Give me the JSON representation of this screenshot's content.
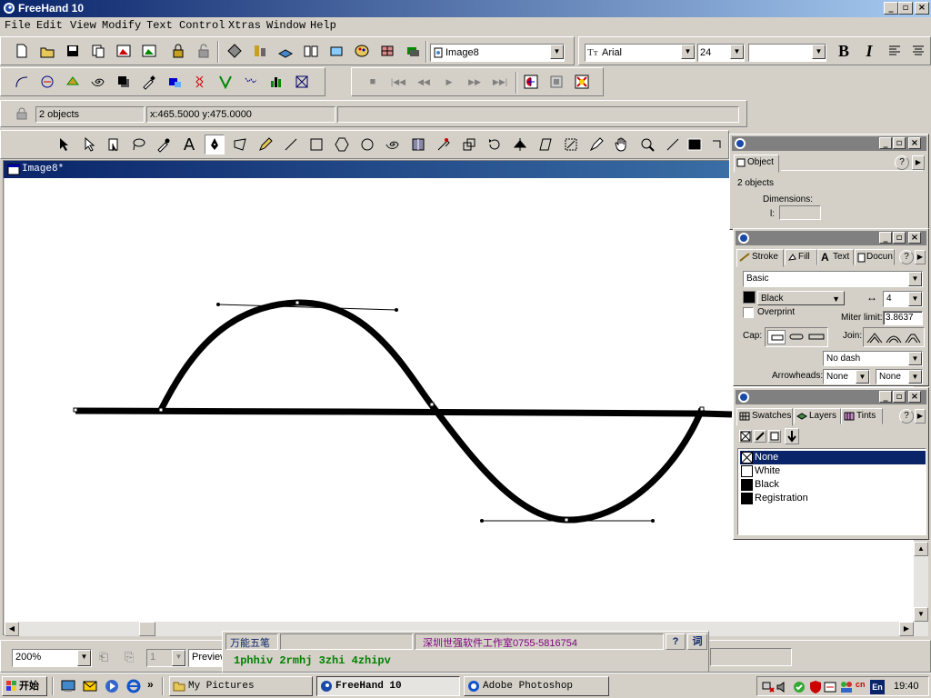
{
  "app": {
    "title": "FreeHand 10"
  },
  "menus": [
    "File",
    "Edit",
    "View",
    "Modify",
    "Text",
    "Control",
    "Xtras",
    "Window",
    "Help"
  ],
  "toolbar": {
    "document_select": "Image8",
    "font_family": "Arial",
    "font_size": "24"
  },
  "status": {
    "selection": "2 objects",
    "coords": "x:465.5000  y:475.0000"
  },
  "document": {
    "title": "Image8*"
  },
  "object_panel": {
    "tab": "Object",
    "summary": "2 objects",
    "dimensions_label": "Dimensions:",
    "l_label": "l:"
  },
  "stroke_panel": {
    "tabs": [
      "Stroke",
      "Fill",
      "Text",
      "Docun"
    ],
    "type": "Basic",
    "color": "Black",
    "width": "4",
    "overprint": "Overprint",
    "miter_label": "Miter limit:",
    "miter_value": "3.8637",
    "cap_label": "Cap:",
    "join_label": "Join:",
    "dash": "No dash",
    "arrowheads_label": "Arrowheads:",
    "arrow_start": "None",
    "arrow_end": "None"
  },
  "swatches_panel": {
    "tabs": [
      "Swatches",
      "Layers",
      "Tints"
    ],
    "items": [
      {
        "name": "None",
        "color": "none",
        "selected": true
      },
      {
        "name": "White",
        "color": "#ffffff",
        "selected": false
      },
      {
        "name": "Black",
        "color": "#000000",
        "selected": false
      },
      {
        "name": "Registration",
        "color": "#000000",
        "selected": false
      }
    ]
  },
  "bottom": {
    "zoom": "200%",
    "page": "1",
    "view_mode": "Preview"
  },
  "ime": {
    "name": "万能五笔",
    "studio": "深圳世强软件工作室0755-5816754",
    "help": "?",
    "word": "词",
    "candidates": "1phhiv 2rmhj 3zhi 4zhipv"
  },
  "taskbar": {
    "start": "开始",
    "tasks": [
      "My Pictures",
      "FreeHand 10",
      "Adobe Photoshop"
    ],
    "lang": "En",
    "time": "19:40"
  },
  "colors": {
    "title_active": "#0a246a",
    "title_gradient_end": "#a6caf0",
    "selection": "#0a246a",
    "ime_text": "#008000",
    "ime_title": "#800080"
  }
}
